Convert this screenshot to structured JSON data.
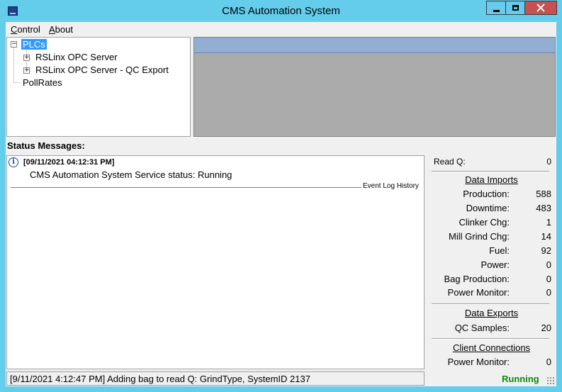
{
  "window": {
    "title": "CMS Automation System"
  },
  "menu": {
    "items": [
      {
        "label_ul": "C",
        "label_rest": "ontrol"
      },
      {
        "label_ul": "A",
        "label_rest": "bout"
      }
    ]
  },
  "tree": {
    "root": {
      "label": "PLCs",
      "expander": "−",
      "selected": true
    },
    "children": [
      {
        "label": "RSLinx OPC Server",
        "expander": "+"
      },
      {
        "label": "RSLinx OPC Server - QC Export",
        "expander": "+"
      }
    ],
    "sibling": {
      "label": "PollRates"
    }
  },
  "status_heading": "Status Messages:",
  "messages": [
    {
      "icon": "info-icon",
      "timestamp": "[09/11/2021 04:12:31 PM]",
      "text": "CMS Automation System Service status: Running"
    }
  ],
  "event_log_label": "Event Log History",
  "stats": {
    "read_q": {
      "label": "Read Q:",
      "value": "0"
    },
    "imports_title": "Data Imports",
    "imports": [
      {
        "label": "Production:",
        "value": "588"
      },
      {
        "label": "Downtime:",
        "value": "483"
      },
      {
        "label": "Clinker Chg:",
        "value": "1"
      },
      {
        "label": "Mill Grind Chg:",
        "value": "14"
      },
      {
        "label": "Fuel:",
        "value": "92"
      },
      {
        "label": "Power:",
        "value": "0"
      },
      {
        "label": "Bag Production:",
        "value": "0"
      },
      {
        "label": "Power Monitor:",
        "value": "0"
      }
    ],
    "exports_title": "Data Exports",
    "exports": [
      {
        "label": "QC Samples:",
        "value": "20"
      }
    ],
    "client_title": "Client Connections",
    "client": [
      {
        "label": "Power Monitor:",
        "value": "0"
      }
    ]
  },
  "statusbar": {
    "text": "[9/11/2021 4:12:47 PM] Adding bag to read Q: GrindType, SystemID 2137",
    "state": "Running",
    "state_color": "#0a8a0a"
  },
  "colors": {
    "titlebar": "#64cdeb",
    "selection": "#3399ff",
    "close_button": "#c75050"
  }
}
